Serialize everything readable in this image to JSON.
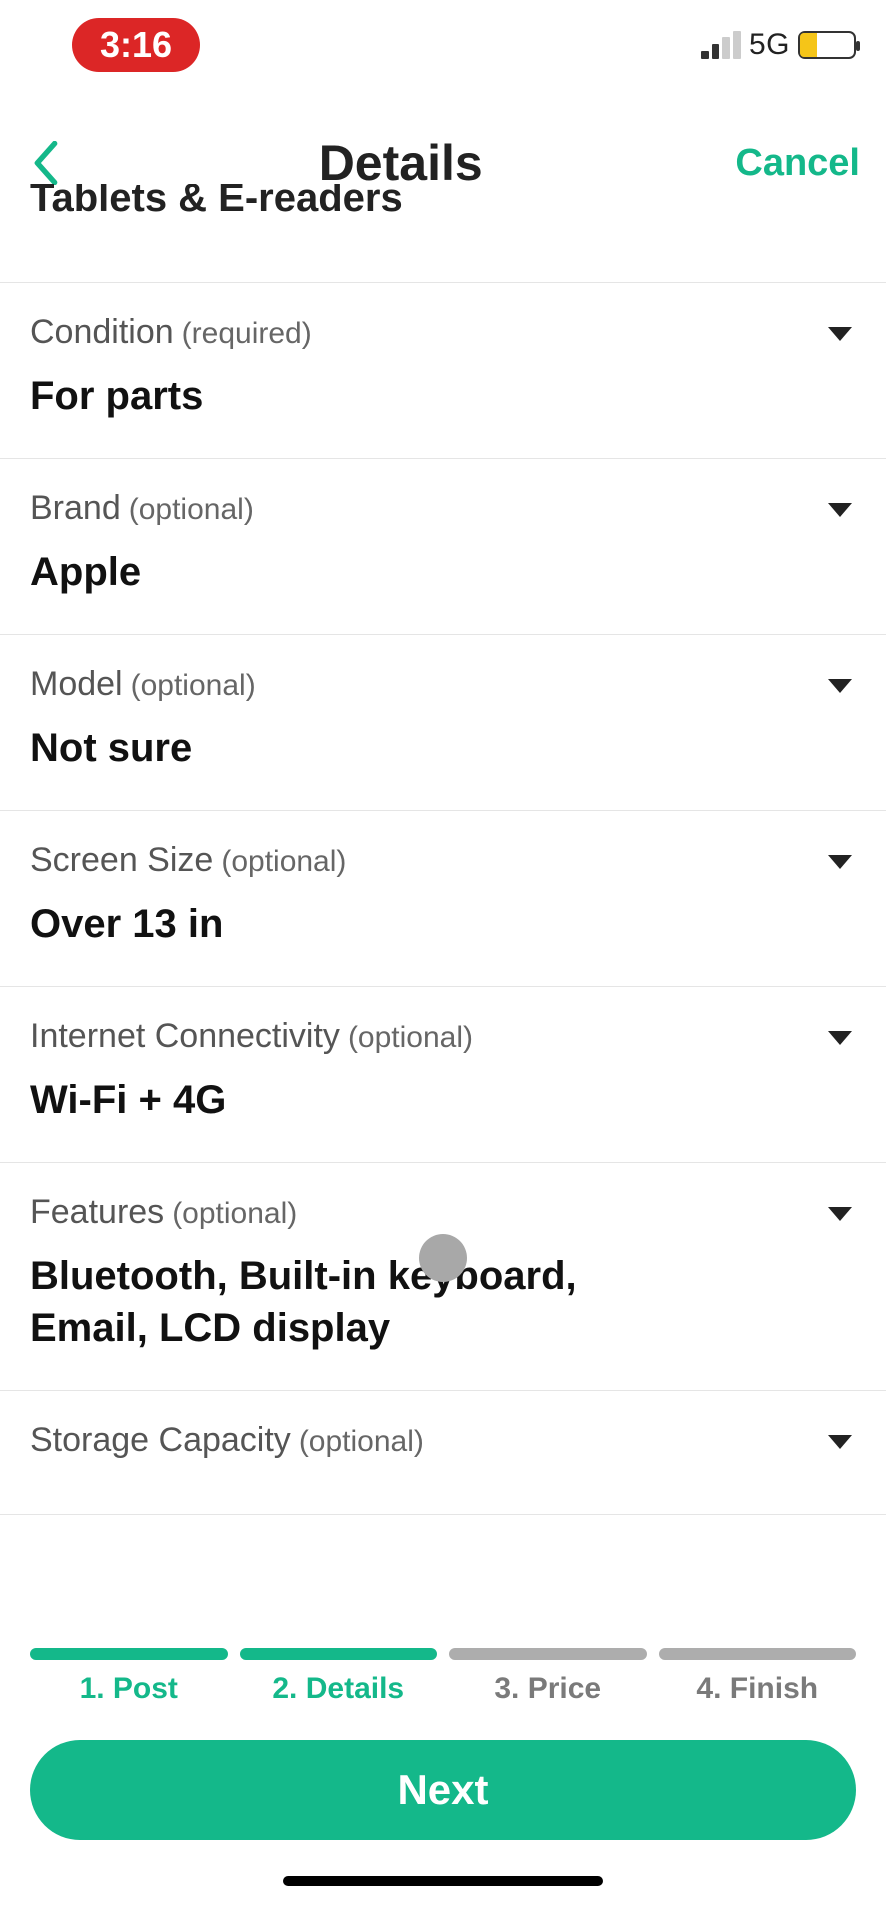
{
  "status_bar": {
    "time": "3:16",
    "network_label": "5G"
  },
  "nav": {
    "title": "Details",
    "cancel": "Cancel"
  },
  "subcategory": "Tablets & E-readers",
  "fields": [
    {
      "label": "Condition",
      "req": "(required)",
      "value": "For parts"
    },
    {
      "label": "Brand",
      "req": "(optional)",
      "value": "Apple"
    },
    {
      "label": "Model",
      "req": "(optional)",
      "value": "Not sure"
    },
    {
      "label": "Screen Size",
      "req": "(optional)",
      "value": "Over 13 in"
    },
    {
      "label": "Internet Connectivity",
      "req": "(optional)",
      "value": "Wi-Fi + 4G"
    },
    {
      "label": "Features",
      "req": "(optional)",
      "value": "Bluetooth, Built-in keyboard, Email, LCD display"
    },
    {
      "label": "Storage Capacity",
      "req": "(optional)",
      "value": ""
    }
  ],
  "progress": {
    "steps": [
      {
        "label": "1. Post",
        "active": true
      },
      {
        "label": "2. Details",
        "active": true
      },
      {
        "label": "3. Price",
        "active": false
      },
      {
        "label": "4. Finish",
        "active": false
      }
    ]
  },
  "next_button": "Next"
}
